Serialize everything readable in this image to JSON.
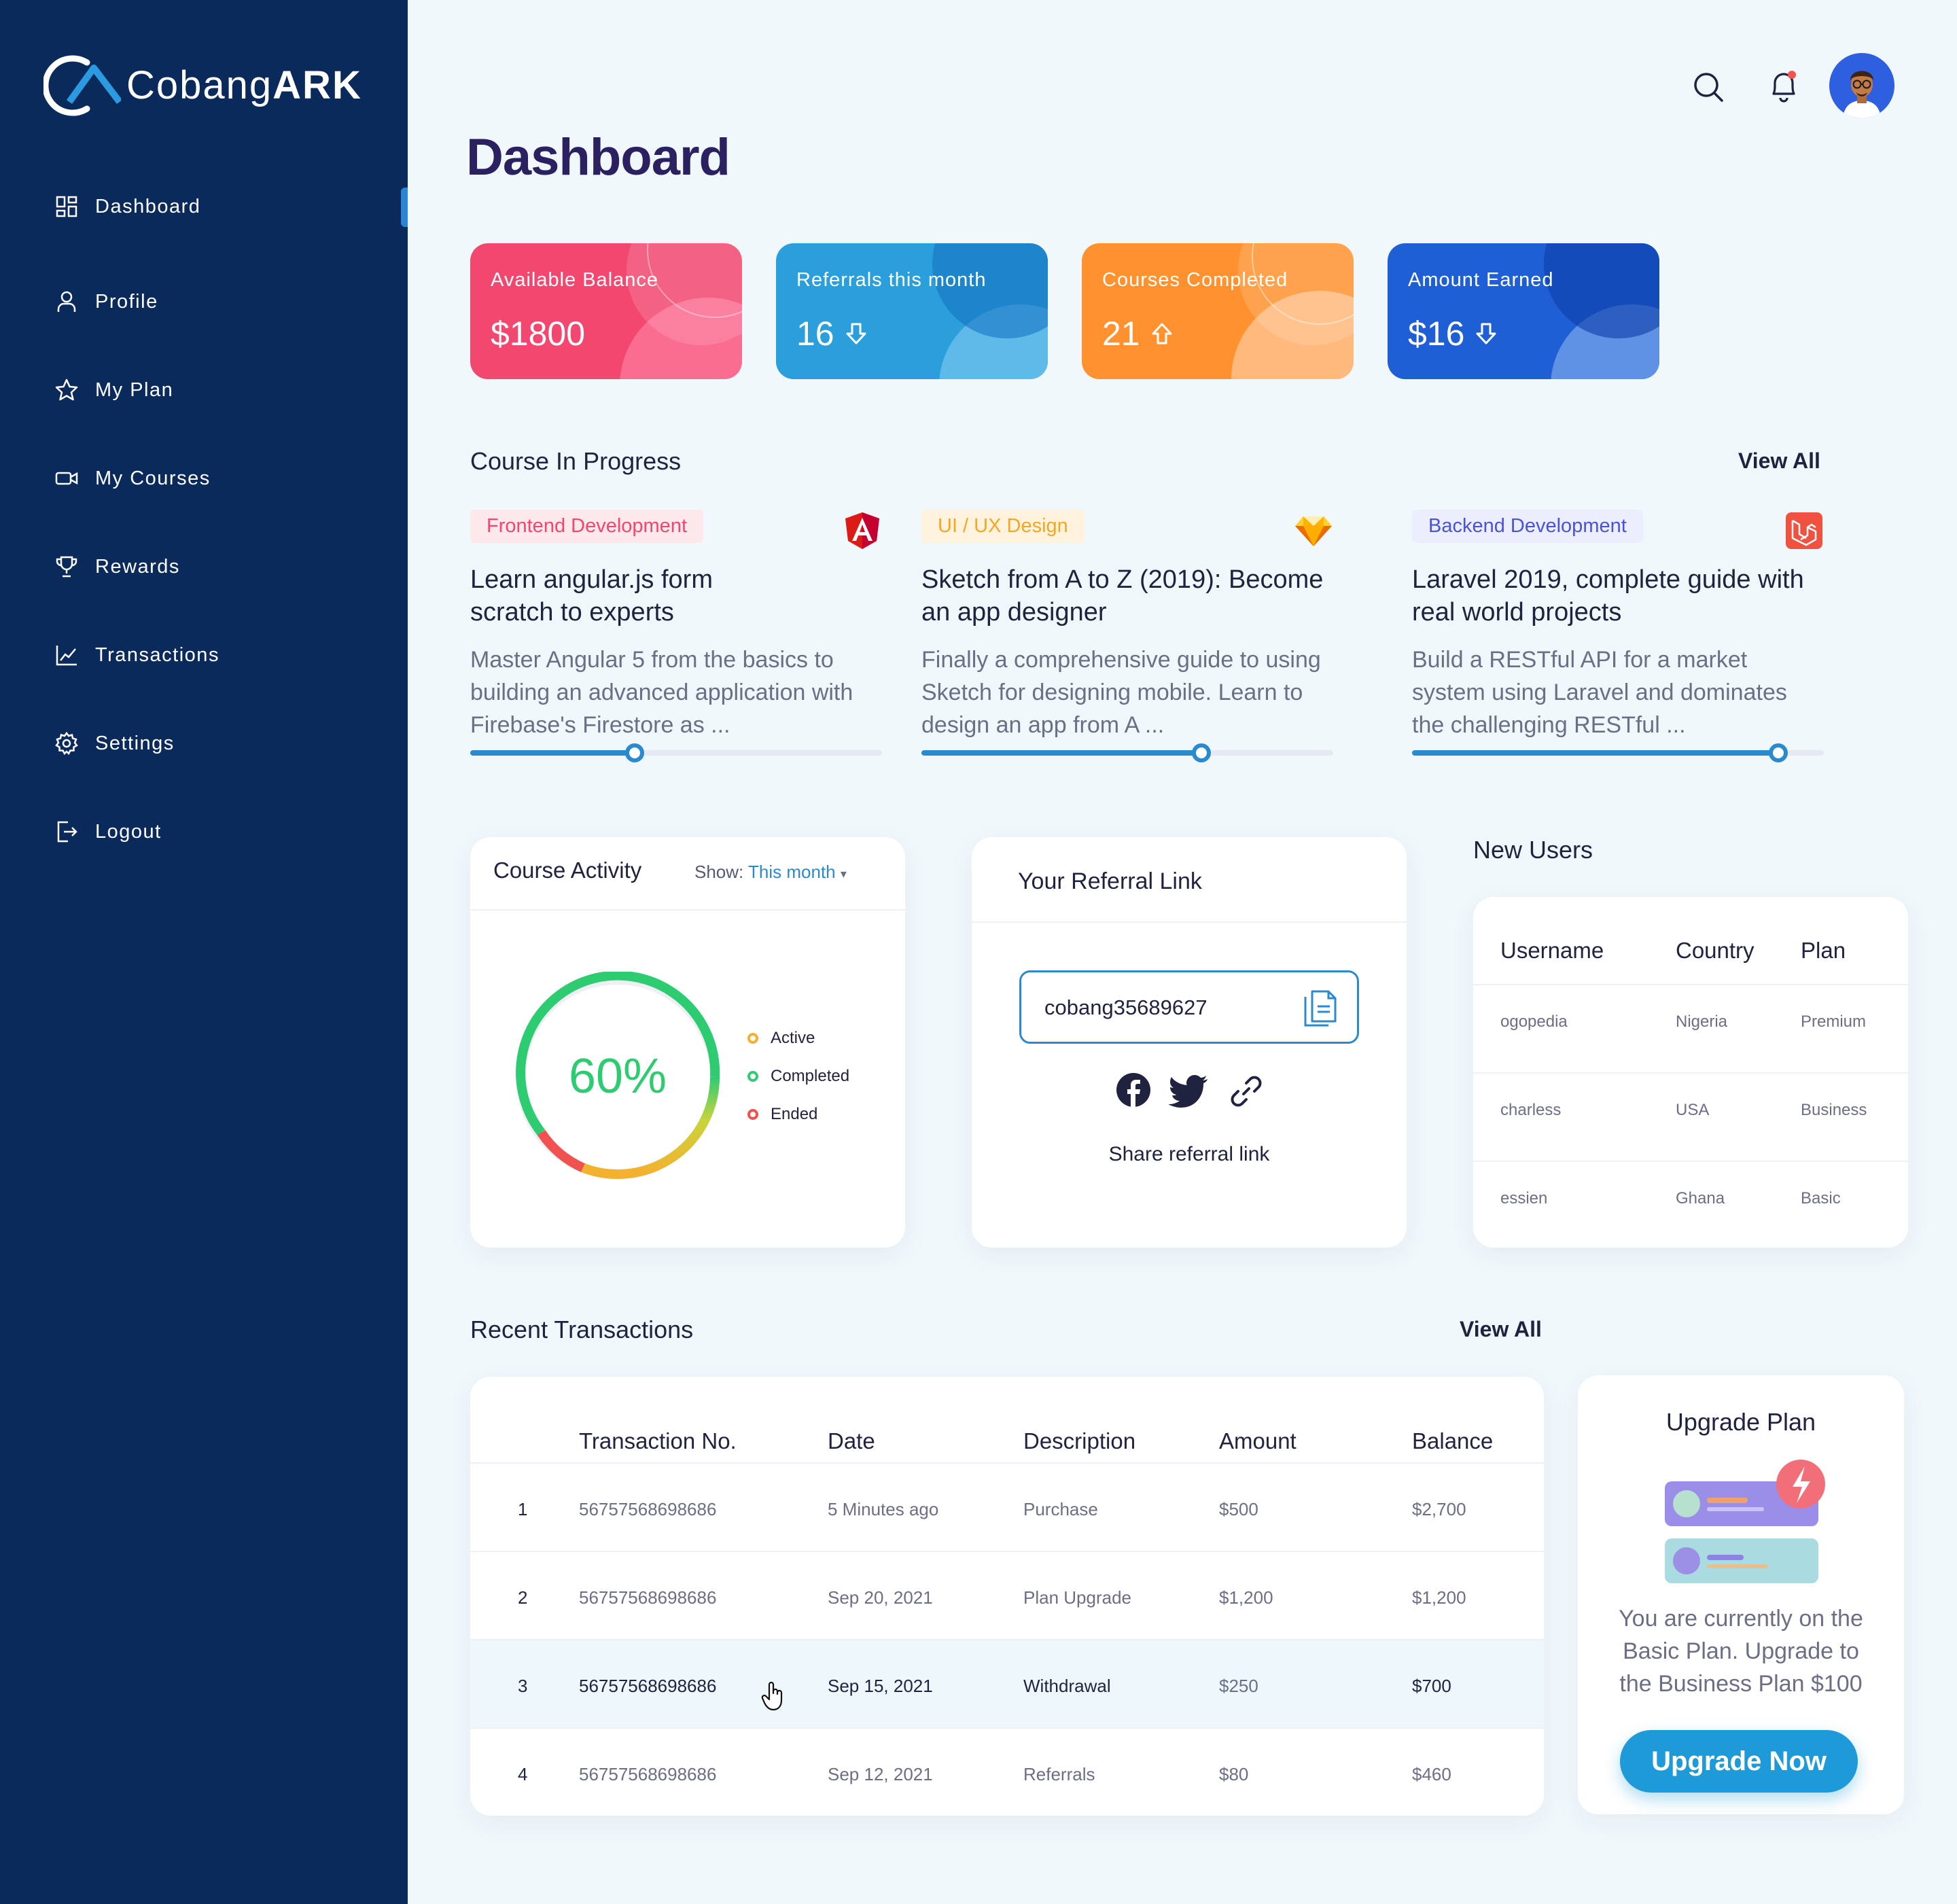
{
  "brand": {
    "name_light": "Cobang",
    "name_bold": "ARK"
  },
  "sidebar": {
    "items": [
      {
        "label": "Dashboard",
        "icon": "grid-icon"
      },
      {
        "label": "Profile",
        "icon": "user-icon"
      },
      {
        "label": "My Plan",
        "icon": "star-icon"
      },
      {
        "label": "My Courses",
        "icon": "video-icon"
      },
      {
        "label": "Rewards",
        "icon": "trophy-icon"
      },
      {
        "label": "Transactions",
        "icon": "chart-line-icon"
      },
      {
        "label": "Settings",
        "icon": "gear-icon"
      },
      {
        "label": "Logout",
        "icon": "logout-icon"
      }
    ],
    "active": "Dashboard"
  },
  "header": {
    "title": "Dashboard"
  },
  "stats": [
    {
      "label": "Available Balance",
      "value": "$1800",
      "trend": "none",
      "color": "#f0476f"
    },
    {
      "label": "Referrals this month",
      "value": "16",
      "trend": "down",
      "color": "#2b9fd9"
    },
    {
      "label": "Courses Completed",
      "value": "21",
      "trend": "up",
      "color": "#fd8f2e"
    },
    {
      "label": "Amount Earned",
      "value": "$16",
      "trend": "down",
      "color": "#1e5fd8"
    }
  ],
  "courses_section": {
    "title": "Course In Progress",
    "view_all": "View All",
    "items": [
      {
        "tag": "Frontend Development",
        "icon": "angular-icon",
        "title": "Learn angular.js form scratch to experts",
        "desc": "Master Angular 5 from the basics to building an advanced application with Firebase's Firestore as ...",
        "progress": 0.4
      },
      {
        "tag": "UI / UX Design",
        "icon": "sketch-icon",
        "title": "Sketch from A to Z (2019): Become an app designer",
        "desc": "Finally a comprehensive guide to using Sketch for designing mobile. Learn to design an app from A ...",
        "progress": 0.68
      },
      {
        "tag": "Backend Development",
        "icon": "laravel-icon",
        "title": "Laravel 2019, complete guide with real world projects",
        "desc": "Build a RESTful API for a market system using Laravel and dominates the challenging RESTful ...",
        "progress": 0.89
      }
    ]
  },
  "course_activity": {
    "title": "Course Activity",
    "show_label": "Show:",
    "show_value": "This month",
    "percent": "60%",
    "legend": [
      {
        "label": "Active",
        "color": "#f5b02f"
      },
      {
        "label": "Completed",
        "color": "#31cc74"
      },
      {
        "label": "Ended",
        "color": "#f0524f"
      }
    ]
  },
  "referral": {
    "title": "Your Referral Link",
    "code": "cobang35689627",
    "share_label": "Share referral link"
  },
  "new_users": {
    "title": "New Users",
    "columns": [
      "Username",
      "Country",
      "Plan"
    ],
    "rows": [
      [
        "ogopedia",
        "Nigeria",
        "Premium"
      ],
      [
        "charless",
        "USA",
        "Business"
      ],
      [
        "essien",
        "Ghana",
        "Basic"
      ]
    ]
  },
  "transactions": {
    "title": "Recent Transactions",
    "view_all": "View All",
    "columns": [
      "Transaction No.",
      "Date",
      "Description",
      "Amount",
      "Balance"
    ],
    "rows": [
      [
        "1",
        "56757568698686",
        "5 Minutes ago",
        "Purchase",
        "$500",
        "$2,700"
      ],
      [
        "2",
        "56757568698686",
        "Sep 20, 2021",
        "Plan Upgrade",
        "$1,200",
        "$1,200"
      ],
      [
        "3",
        "56757568698686",
        "Sep 15, 2021",
        "Withdrawal",
        "$250",
        "$700"
      ],
      [
        "4",
        "56757568698686",
        "Sep 12, 2021",
        "Referrals",
        "$80",
        "$460"
      ]
    ]
  },
  "upgrade": {
    "title": "Upgrade Plan",
    "text": "You are currently on the Basic Plan. Upgrade to the Business Plan $100",
    "button": "Upgrade Now"
  }
}
